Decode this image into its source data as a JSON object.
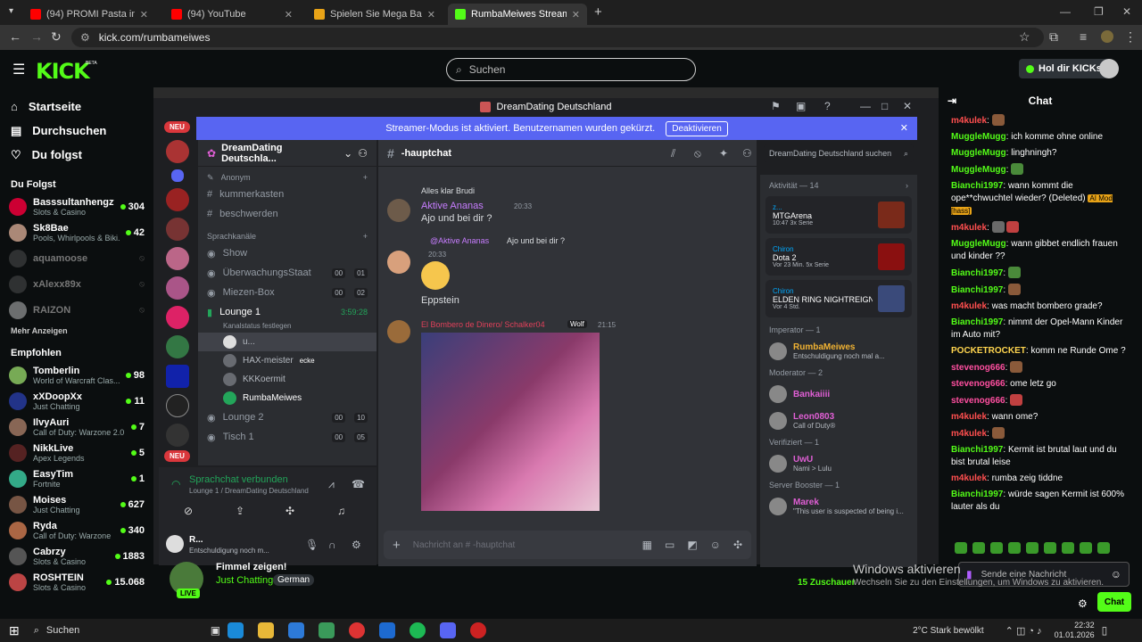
{
  "browser": {
    "tabs": [
      {
        "title": "(94) PROMI Pasta in NEW YORK",
        "color": "#ff0000"
      },
      {
        "title": "(94) YouTube",
        "color": "#ff0000"
      },
      {
        "title": "Spielen Sie Mega Ball im Sol Ca",
        "color": "#e8a317"
      },
      {
        "title": "RumbaMeiwes Stream - Watch",
        "color": "#53fc18"
      }
    ],
    "url": "kick.com/rumbameiwes"
  },
  "kick": {
    "logo": "KICK",
    "beta": "BETA",
    "search_placeholder": "Suchen",
    "get_kicks": "Hol dir KICKs",
    "nav": [
      {
        "label": "Startseite",
        "icon": "home-icon"
      },
      {
        "label": "Durchsuchen",
        "icon": "browse-icon"
      },
      {
        "label": "Du folgst",
        "icon": "heart-icon"
      }
    ],
    "following_title": "Du Folgst",
    "following": [
      {
        "name": "Basssultanhengzt...",
        "game": "Slots & Casino",
        "viewers": "304",
        "online": true,
        "color": "#c03"
      },
      {
        "name": "Sk8Bae",
        "game": "Pools, Whirlpools & Biki...",
        "viewers": "42",
        "online": true,
        "color": "#a87"
      },
      {
        "name": "aquamoose",
        "game": "",
        "viewers": "",
        "online": false,
        "color": "#666"
      },
      {
        "name": "xAlexx89x",
        "game": "",
        "viewers": "",
        "online": false,
        "color": "#666"
      },
      {
        "name": "RAIZON",
        "game": "",
        "viewers": "",
        "online": false,
        "color": "#fff"
      }
    ],
    "more": "Mehr Anzeigen",
    "recommended_title": "Empfohlen",
    "recommended": [
      {
        "name": "Tomberlin",
        "game": "World of Warcraft Clas...",
        "viewers": "98",
        "color": "#7a5"
      },
      {
        "name": "xXDoopXx",
        "game": "Just Chatting",
        "viewers": "11",
        "color": "#238"
      },
      {
        "name": "IlvyAuri",
        "game": "Call of Duty: Warzone 2.0",
        "viewers": "7",
        "color": "#865"
      },
      {
        "name": "NikkLive",
        "game": "Apex Legends",
        "viewers": "5",
        "color": "#522"
      },
      {
        "name": "EasyTim",
        "game": "Fortnite",
        "viewers": "1",
        "color": "#3a8"
      },
      {
        "name": "Moises",
        "game": "Just Chatting",
        "viewers": "627",
        "color": "#754"
      },
      {
        "name": "Ryda",
        "game": "Call of Duty: Warzone",
        "viewers": "340",
        "color": "#a64"
      },
      {
        "name": "Cabrzy",
        "game": "Slots & Casino",
        "viewers": "1883",
        "color": "#555"
      },
      {
        "name": "ROSHTEIN",
        "game": "Slots & Casino",
        "viewers": "15.068",
        "color": "#b44"
      }
    ],
    "stream": {
      "title": "Fimmel zeigen!",
      "category": "Just Chatting",
      "tag": "German",
      "live": "LIVE",
      "viewers": "15 Zuschauer"
    },
    "chat": {
      "title": "Chat",
      "input_placeholder": "Sende eine Nachricht",
      "send": "Chat",
      "messages": [
        {
          "user": "m4kulek",
          "color": "#ff4f4f",
          "text": "",
          "emotes": 1
        },
        {
          "user": "MuggleMugg",
          "color": "#53fc18",
          "text": "ich komme ohne online",
          "emotes": 0
        },
        {
          "user": "MuggleMugg",
          "color": "#53fc18",
          "text": "linghningh?",
          "emotes": 0
        },
        {
          "user": "MuggleMugg",
          "color": "#53fc18",
          "text": "",
          "emotes": 1
        },
        {
          "user": "Bianchi1997",
          "color": "#53fc18",
          "text": "wann kommt die ope**chwuchtel wieder? (Deleted)",
          "extra": "AI Mod [hass]",
          "emotes": 0
        },
        {
          "user": "m4kulek",
          "color": "#ff4f4f",
          "text": "",
          "emotes": 2
        },
        {
          "user": "MuggleMugg",
          "color": "#53fc18",
          "text": "wann gibbet endlich frauen und kinder ??",
          "emotes": 0
        },
        {
          "user": "Bianchi1997",
          "color": "#53fc18",
          "text": "",
          "emotes": 1
        },
        {
          "user": "Bianchi1997",
          "color": "#53fc18",
          "text": "",
          "emotes": 1
        },
        {
          "user": "m4kulek",
          "color": "#ff4f4f",
          "text": "was macht bombero grade?",
          "emotes": 0
        },
        {
          "user": "Bianchi1997",
          "color": "#53fc18",
          "text": "nimmt der Opel-Mann Kinder im Auto mit?",
          "emotes": 0
        },
        {
          "user": "POCKETROCKET",
          "color": "#ffd54f",
          "text": "komm ne Runde Ome ?",
          "emotes": 0
        },
        {
          "user": "stevenog666",
          "color": "#ff4fa0",
          "text": "",
          "emotes": 1
        },
        {
          "user": "stevenog666",
          "color": "#ff4fa0",
          "text": "ome letz go",
          "emotes": 0
        },
        {
          "user": "stevenog666",
          "color": "#ff4fa0",
          "text": "",
          "emotes": 1
        },
        {
          "user": "m4kulek",
          "color": "#ff4f4f",
          "text": "wann ome?",
          "emotes": 0
        },
        {
          "user": "m4kulek",
          "color": "#ff4f4f",
          "text": "",
          "emotes": 1
        },
        {
          "user": "Bianchi1997",
          "color": "#53fc18",
          "text": "Kermit ist brutal laut und du bist brutal leise",
          "emotes": 0
        },
        {
          "user": "m4kulek",
          "color": "#ff4f4f",
          "text": "rumba zeig tiddne",
          "emotes": 0
        },
        {
          "user": "Bianchi1997",
          "color": "#53fc18",
          "text": "würde sagen Kermit ist 600% lauter als du",
          "emotes": 0
        }
      ]
    }
  },
  "discord": {
    "window_title": "DreamDating Deutschland",
    "banner": "Streamer-Modus ist aktiviert. Benutzernamen wurden gekürzt.",
    "banner_button": "Deaktivieren",
    "new_badge": "NEU",
    "server_name": "DreamDating Deutschla...",
    "channel": "-hauptchat",
    "search": "DreamDating Deutschland suchen",
    "category_anon": "Anonym",
    "text_channels": [
      "kummerkasten",
      "beschwerden"
    ],
    "voice_category": "Sprachkanäle",
    "voice": [
      {
        "name": "Show",
        "a": "",
        "b": ""
      },
      {
        "name": "ÜberwachungsStaat",
        "a": "00",
        "b": "01"
      },
      {
        "name": "Miezen-Box",
        "a": "00",
        "b": "02"
      },
      {
        "name": "Lounge 1",
        "a": "",
        "b": "",
        "time": "3:59:28",
        "status": "Kanalstatus festlegen"
      }
    ],
    "lounge_users": [
      "u...",
      "HAX-meister",
      "KKKoermit",
      "RumbaMeiwes"
    ],
    "hax_tag": "ecke",
    "voice2": [
      {
        "name": "Lounge 2",
        "a": "00",
        "b": "10"
      },
      {
        "name": "Tisch 1",
        "a": "00",
        "b": "05"
      }
    ],
    "voice_connected": "Sprachchat verbunden",
    "voice_where": "Lounge 1 / DreamDating Deutschland",
    "me": "R...",
    "me_status": "Entschuldigung noch m...",
    "messages": {
      "reply1": "Alles klar Brudi",
      "user1": "Aktive Ananas",
      "time1": "20:33",
      "text1": "Ajo und bei dir ?",
      "reply2": "@Aktive Ananas",
      "reply2text": "Ajo und bei dir ?",
      "time2": "20:33",
      "text2": "Eppstein",
      "user3": "El Bombero de Dinero/ Schalker04",
      "tag3": "Wolf",
      "time3": "21:15"
    },
    "input_placeholder": "Nachricht an # -hauptchat",
    "activity_title": "Aktivität — 14",
    "activities": [
      {
        "user": "z...",
        "game": "MTGArena",
        "meta1": "10:47",
        "meta2": "3x Serie"
      },
      {
        "user": "Chiron",
        "game": "Dota 2",
        "meta1": "Vor 23 Min.",
        "meta2": "5x Serie"
      },
      {
        "user": "Chiron",
        "game": "ELDEN RING NIGHTREIGN",
        "meta1": "Vor 4 Std.",
        "meta2": ""
      }
    ],
    "roles": [
      {
        "title": "Imperator — 1",
        "members": [
          {
            "name": "RumbaMeiwes",
            "sub": "Entschuldigung noch mal a...",
            "color": "#f0b232"
          }
        ]
      },
      {
        "title": "Moderator — 2",
        "members": [
          {
            "name": "Bankaiiii",
            "sub": "",
            "color": "#e05fd5"
          },
          {
            "name": "Leon0803",
            "sub": "Call of Duty®",
            "color": "#e05fd5"
          }
        ]
      },
      {
        "title": "Verifiziert — 1",
        "members": [
          {
            "name": "UwU",
            "sub": "Nami > Lulu",
            "color": "#e05fd5"
          }
        ]
      },
      {
        "title": "Server Booster — 1",
        "members": [
          {
            "name": "Marek",
            "sub": "\"This user is suspected of being i...",
            "color": "#e05fd5"
          }
        ]
      }
    ]
  },
  "windows": {
    "activate": "Windows aktivieren",
    "activate_sub": "Wechseln Sie zu den Einstellungen, um Windows zu aktivieren.",
    "search": "Suchen",
    "weather": "2°C Stark bewölkt",
    "time": "22:32",
    "date": "01.01.2026"
  }
}
